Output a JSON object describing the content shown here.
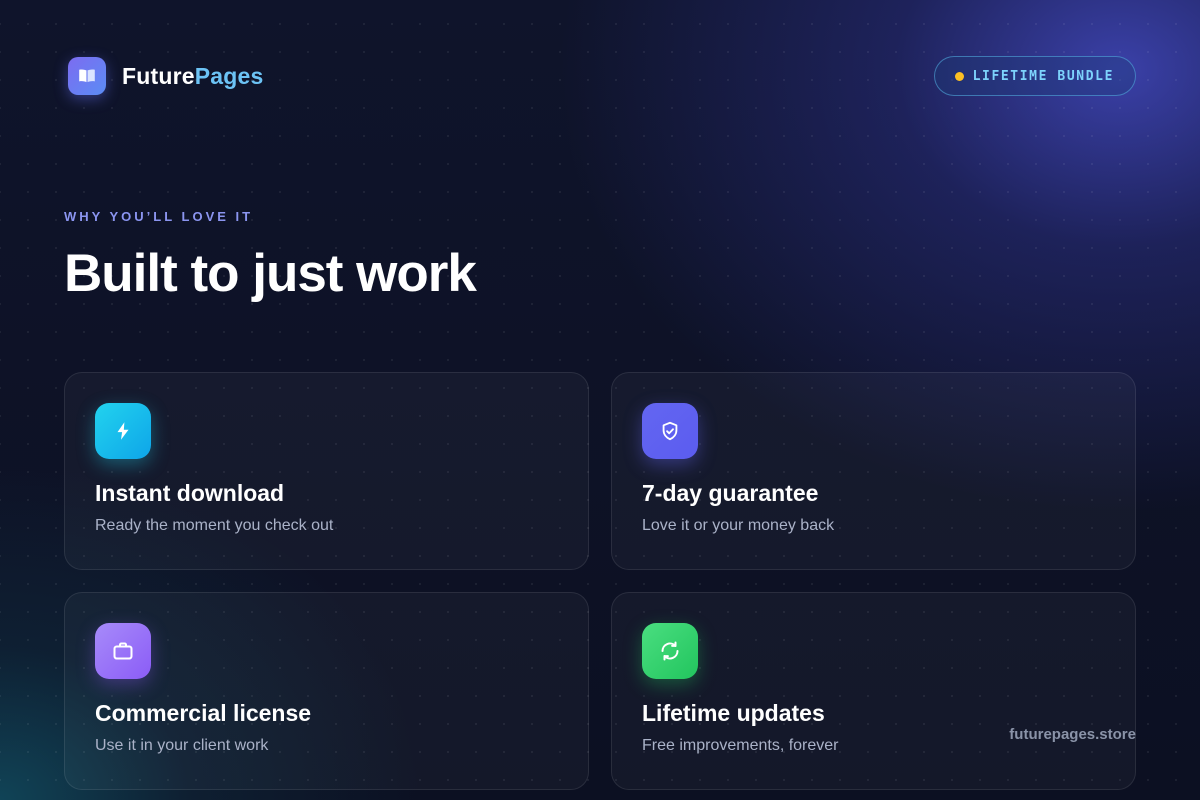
{
  "brand": {
    "name_part1": "Future",
    "name_part2": "Pages",
    "logo_icon": "open-book-icon"
  },
  "badge": {
    "label": "LIFETIME BUNDLE",
    "dot_color": "#fbbf24"
  },
  "hero": {
    "eyebrow": "WHY YOU’LL LOVE IT",
    "headline": "Built to just work"
  },
  "features": [
    {
      "icon": "lightning-bolt-icon",
      "color": "#22d3ee",
      "title": "Instant download",
      "description": "Ready the moment you check out"
    },
    {
      "icon": "shield-check-icon",
      "color": "#6366f1",
      "title": "7-day guarantee",
      "description": "Love it or your money back"
    },
    {
      "icon": "briefcase-icon",
      "color": "#8b5cf6",
      "title": "Commercial license",
      "description": "Use it in your client work"
    },
    {
      "icon": "refresh-icon",
      "color": "#22c55e",
      "title": "Lifetime updates",
      "description": "Free improvements, forever"
    }
  ],
  "footer": {
    "url": "futurepages.store"
  }
}
